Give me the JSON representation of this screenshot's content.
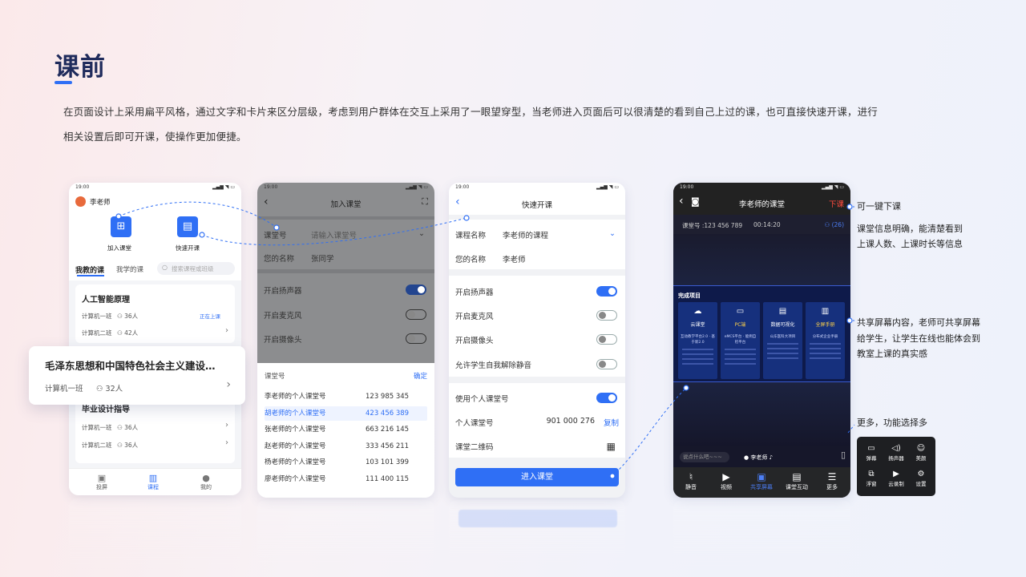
{
  "page": {
    "title": "课前",
    "desc_line1": "在页面设计上采用扁平风格，通过文字和卡片来区分层级，考虑到用户群体在交互上采用了一眼望穿型，当老师进入页面后可以很清楚的看到自己上过的课，也可直接快速开课，进行",
    "desc_line2": "相关设置后即可开课，使操作更加便捷。"
  },
  "status_time": "19:00",
  "screen1": {
    "user": "李老师",
    "join_label": "加入课堂",
    "quick_label": "快速开课",
    "tab_teach": "我教的课",
    "tab_learn": "我学的课",
    "search_placeholder": "搜索课程或班级",
    "course1": {
      "title": "人工智能原理",
      "rows": [
        {
          "cls": "计算机一班",
          "count": "36人",
          "status": "正在上课"
        },
        {
          "cls": "计算机二班",
          "count": "42人"
        }
      ]
    },
    "course3": {
      "title": "毕业设计指导",
      "rows": [
        {
          "cls": "计算机一班",
          "count": "36人"
        },
        {
          "cls": "计算机二班",
          "count": "36人"
        }
      ]
    },
    "nav": [
      "投屏",
      "课程",
      "我的"
    ]
  },
  "popup": {
    "title": "毛泽东思想和中国特色社会主义建设…",
    "cls": "计算机一班",
    "count": "32人"
  },
  "screen2": {
    "title": "加入课堂",
    "room_label": "课堂号",
    "room_placeholder": "请输入课堂号",
    "name_label": "您的名称",
    "name_value": "张同学",
    "toggles": [
      "开启扬声器",
      "开启麦克风",
      "开启摄像头"
    ],
    "sheet_title": "课堂号",
    "sheet_confirm": "确定",
    "list": [
      {
        "name": "李老师的个人课堂号",
        "num": "123 985 345"
      },
      {
        "name": "胡老师的个人课堂号",
        "num": "423 456 389"
      },
      {
        "name": "张老师的个人课堂号",
        "num": "663 216 145"
      },
      {
        "name": "赵老师的个人课堂号",
        "num": "333 456 211"
      },
      {
        "name": "杨老师的个人课堂号",
        "num": "103 101 399"
      },
      {
        "name": "廖老师的个人课堂号",
        "num": "111 400 115"
      }
    ]
  },
  "screen3": {
    "title": "快速开课",
    "course_label": "课程名称",
    "course_value": "李老师的课程",
    "name_label": "您的名称",
    "name_value": "李老师",
    "toggles": [
      "开启扬声器",
      "开启麦克风",
      "开启摄像头",
      "允许学生自我解除静音"
    ],
    "personal_label": "使用个人课堂号",
    "room_label": "个人课堂号",
    "room_value": "901 000 276",
    "copy": "复制",
    "qr_label": "课堂二维码",
    "enter": "进入课堂"
  },
  "screen4": {
    "title": "李老师的课堂",
    "end": "下课",
    "room_info": "课堂号 :123 456 789",
    "time": "00:14:20",
    "count": "(26)",
    "share_title": "完成项目",
    "cards": [
      {
        "t": "云课堂",
        "s": "互动教学平台2.0 · 基于新2.0"
      },
      {
        "t": "PC端",
        "s": "eMCS平台 · 能例自检平台"
      },
      {
        "t": "数据可视化",
        "s": "山东医科大项目"
      },
      {
        "t": "全屏手册",
        "s": "分布式企业手册"
      }
    ],
    "input_placeholder": "说点什么吧~~~",
    "speaker": "李老师",
    "bar": [
      "静音",
      "视频",
      "共享屏幕",
      "课堂互动",
      "更多"
    ]
  },
  "more_menu": [
    "弹幕",
    "扬声器",
    "美颜",
    "浮窗",
    "云录制",
    "设置"
  ],
  "annotations": [
    "可一键下课",
    "课堂信息明确，能清楚看到",
    "上课人数、上课时长等信息",
    "共享屏幕内容，老师可共享屏幕",
    "给学生，让学生在线也能体会到",
    "教室上课的真实感",
    "更多，功能选择多"
  ],
  "colors": {
    "accent": "#2f6ff5",
    "title": "#1f2b5c",
    "dark": "#1a1c2c",
    "end_red": "#ff4b3e"
  }
}
